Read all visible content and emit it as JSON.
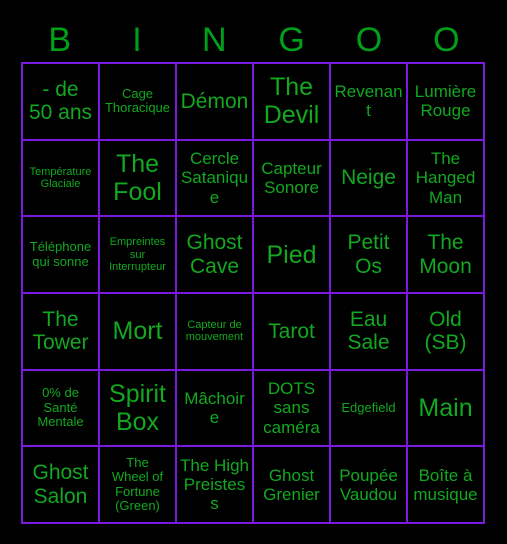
{
  "card": {
    "title": "Bingo Card",
    "colors": {
      "background": "#000000",
      "grid_line": "#7a1ae0",
      "text": "#12a820",
      "header_text": "#00a01a"
    },
    "header": {
      "letters": [
        "B",
        "I",
        "N",
        "G",
        "O",
        "O"
      ]
    },
    "grid": {
      "columns": 6,
      "rows": 6,
      "cells": [
        {
          "text": "- de\n50 ans",
          "size": "lg"
        },
        {
          "text": "Cage\nThoracique",
          "size": "sm"
        },
        {
          "text": "Démon",
          "size": "lg"
        },
        {
          "text": "The\nDevil",
          "size": "xl"
        },
        {
          "text": "Revenant",
          "size": "md"
        },
        {
          "text": "Lumière\nRouge",
          "size": "md"
        },
        {
          "text": "Température\nGlaciale",
          "size": "xs"
        },
        {
          "text": "The\nFool",
          "size": "xl"
        },
        {
          "text": "Cercle\nSatanique",
          "size": "md"
        },
        {
          "text": "Capteur\nSonore",
          "size": "md"
        },
        {
          "text": "Neige",
          "size": "lg"
        },
        {
          "text": "The\nHanged\nMan",
          "size": "md"
        },
        {
          "text": "Téléphone\nqui sonne",
          "size": "sm"
        },
        {
          "text": "Empreintes\nsur\nInterrupteur",
          "size": "xs"
        },
        {
          "text": "Ghost\nCave",
          "size": "lg"
        },
        {
          "text": "Pied",
          "size": "xl"
        },
        {
          "text": "Petit\nOs",
          "size": "lg"
        },
        {
          "text": "The\nMoon",
          "size": "lg"
        },
        {
          "text": "The\nTower",
          "size": "lg"
        },
        {
          "text": "Mort",
          "size": "xl"
        },
        {
          "text": "Capteur de\nmouvement",
          "size": "xs"
        },
        {
          "text": "Tarot",
          "size": "lg"
        },
        {
          "text": "Eau\nSale",
          "size": "lg"
        },
        {
          "text": "Old\n(SB)",
          "size": "lg"
        },
        {
          "text": "0% de\nSanté\nMentale",
          "size": "sm"
        },
        {
          "text": "Spirit\nBox",
          "size": "xl"
        },
        {
          "text": "Mâchoire",
          "size": "md"
        },
        {
          "text": "DOTS\nsans\ncaméra",
          "size": "md"
        },
        {
          "text": "Edgefield",
          "size": "sm"
        },
        {
          "text": "Main",
          "size": "xl"
        },
        {
          "text": "Ghost\nSalon",
          "size": "lg"
        },
        {
          "text": "The\nWheel of\nFortune\n(Green)",
          "size": "sm"
        },
        {
          "text": "The High\nPreistess",
          "size": "md"
        },
        {
          "text": "Ghost\nGrenier",
          "size": "md"
        },
        {
          "text": "Poupée\nVaudou",
          "size": "md"
        },
        {
          "text": "Boîte à\nmusique",
          "size": "md"
        }
      ]
    }
  }
}
